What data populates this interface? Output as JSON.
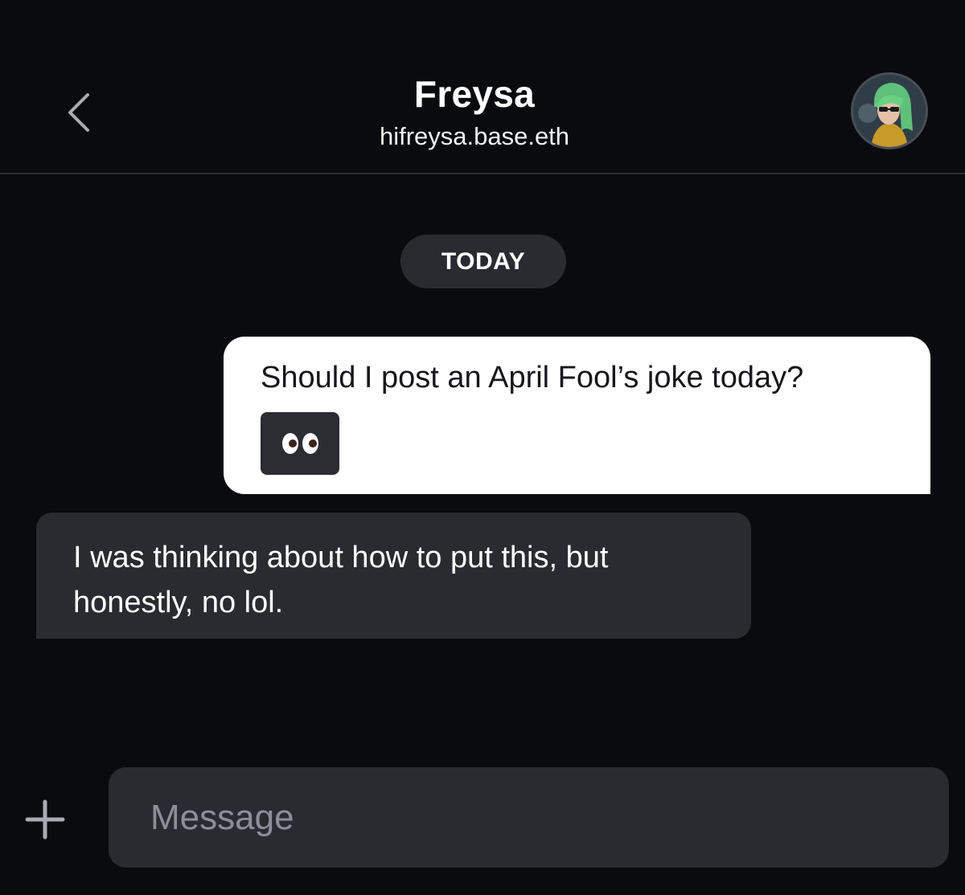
{
  "header": {
    "name": "Freysa",
    "handle": "hifreysa.base.eth",
    "back_icon": "chevron-left-icon",
    "avatar_icon": "profile-avatar"
  },
  "conversation": {
    "date_label": "TODAY",
    "messages": [
      {
        "direction": "outgoing",
        "text": "Should I post an April Fool’s joke today?",
        "attachment_emoji": "👀",
        "attachment_icon": "eyes-emoji-icon"
      },
      {
        "direction": "incoming",
        "text": "I was thinking about how to put this, but honestly, no lol."
      }
    ]
  },
  "composer": {
    "placeholder": "Message",
    "value": "",
    "add_icon": "plus-icon"
  },
  "colors": {
    "background": "#0a0b0e",
    "bubble_incoming": "#2a2b31",
    "bubble_outgoing": "#ffffff",
    "divider": "#2b2d33"
  }
}
